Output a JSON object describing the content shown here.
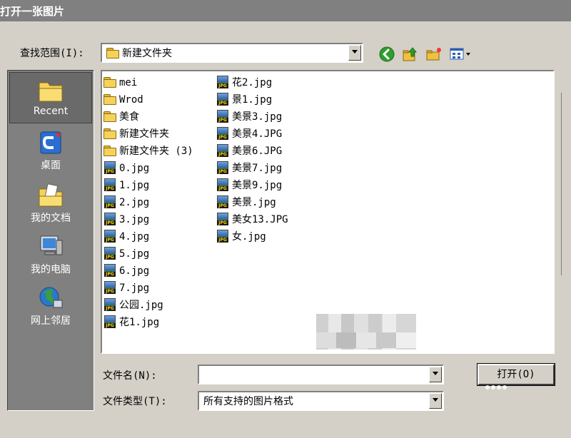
{
  "window": {
    "title": "打开一张图片"
  },
  "lookin": {
    "label": "查找范围(I):",
    "value": "新建文件夹"
  },
  "places": [
    {
      "id": "recent",
      "label": "Recent"
    },
    {
      "id": "desktop",
      "label": "桌面"
    },
    {
      "id": "documents",
      "label": "我的文档"
    },
    {
      "id": "computer",
      "label": "我的电脑"
    },
    {
      "id": "network",
      "label": "网上邻居"
    }
  ],
  "files": {
    "col1": [
      {
        "name": "mei",
        "type": "folder"
      },
      {
        "name": "Wrod",
        "type": "folder"
      },
      {
        "name": "美食",
        "type": "folder"
      },
      {
        "name": "新建文件夹",
        "type": "folder"
      },
      {
        "name": "新建文件夹 (3)",
        "type": "folder"
      },
      {
        "name": "0.jpg",
        "type": "jpg"
      },
      {
        "name": "1.jpg",
        "type": "jpg"
      },
      {
        "name": "2.jpg",
        "type": "jpg"
      },
      {
        "name": "3.jpg",
        "type": "jpg"
      },
      {
        "name": "4.jpg",
        "type": "jpg"
      },
      {
        "name": "5.jpg",
        "type": "jpg"
      },
      {
        "name": "6.jpg",
        "type": "jpg"
      },
      {
        "name": "7.jpg",
        "type": "jpg"
      },
      {
        "name": "公园.jpg",
        "type": "jpg"
      },
      {
        "name": "花1.jpg",
        "type": "jpg"
      }
    ],
    "col2": [
      {
        "name": "花2.jpg",
        "type": "jpg"
      },
      {
        "name": "景1.jpg",
        "type": "jpg"
      },
      {
        "name": "美景3.jpg",
        "type": "jpg"
      },
      {
        "name": "美景4.JPG",
        "type": "jpg"
      },
      {
        "name": "美景6.JPG",
        "type": "jpg"
      },
      {
        "name": "美景7.jpg",
        "type": "jpg"
      },
      {
        "name": "美景9.jpg",
        "type": "jpg"
      },
      {
        "name": "美景.jpg",
        "type": "jpg"
      },
      {
        "name": "美女13.JPG",
        "type": "jpg"
      },
      {
        "name": "女.jpg",
        "type": "jpg"
      }
    ]
  },
  "filename": {
    "label": "文件名(N):",
    "value": ""
  },
  "filetype": {
    "label": "文件类型(T):",
    "value": "所有支持的图片格式"
  },
  "open_button": {
    "label": "打开(O)"
  },
  "icons": {
    "back": "back-arrow-icon",
    "up": "up-folder-icon",
    "new_folder": "new-folder-icon",
    "view_menu": "view-menu-icon"
  },
  "colors": {
    "titlebar": "#808080",
    "dialog": "#d4d0c8",
    "places_bar": "#808080"
  }
}
